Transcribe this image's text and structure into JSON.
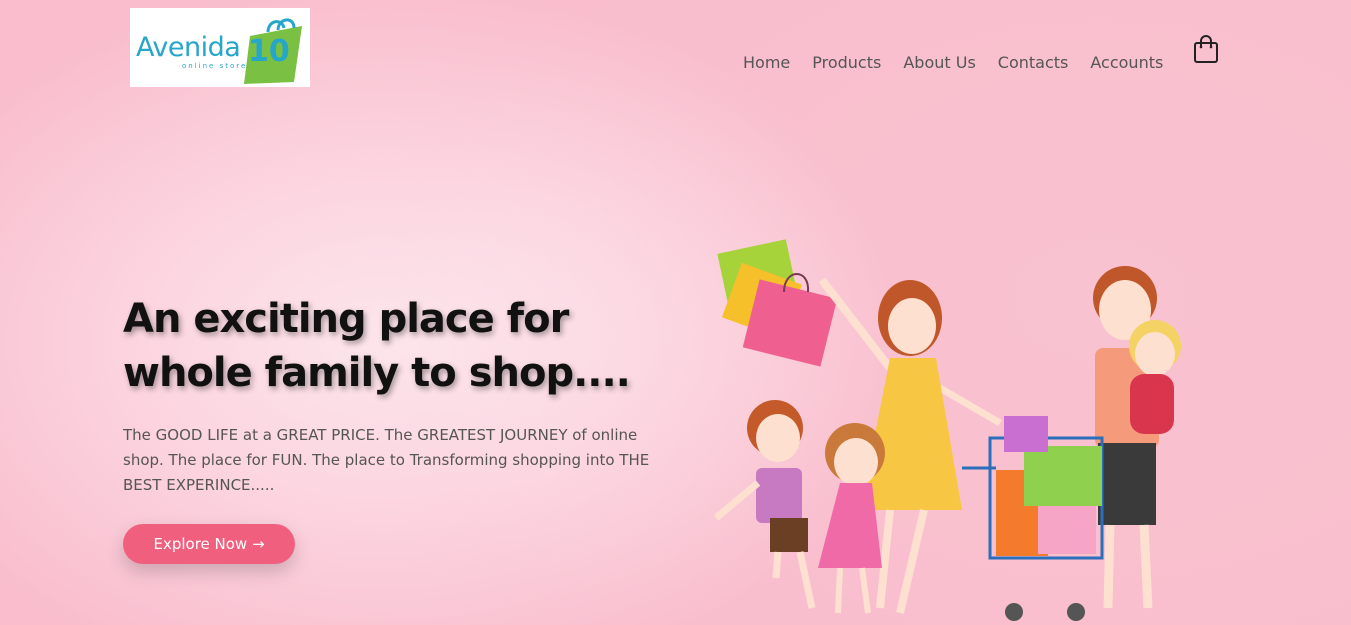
{
  "brand": {
    "name": "Avenida",
    "number": "10",
    "tagline": "online store"
  },
  "nav": {
    "items": [
      "Home",
      "Products",
      "About Us",
      "Contacts",
      "Accounts"
    ]
  },
  "hero": {
    "title_line1": "An exciting place for",
    "title_line2": "whole family to shop....",
    "description": "The GOOD LIFE at a GREAT PRICE. The GREATEST JOURNEY of online shop. The place for FUN. The place to Transforming shopping into THE BEST EXPERINCE.....",
    "cta": "Explore Now →"
  },
  "icons": {
    "cart": "shopping-bag-icon",
    "logo": "shopping-bag-logo"
  },
  "colors": {
    "accent": "#f0607e",
    "brand": "#26a6c9",
    "brand_green": "#7ac143",
    "background": "#f9c2d0"
  }
}
